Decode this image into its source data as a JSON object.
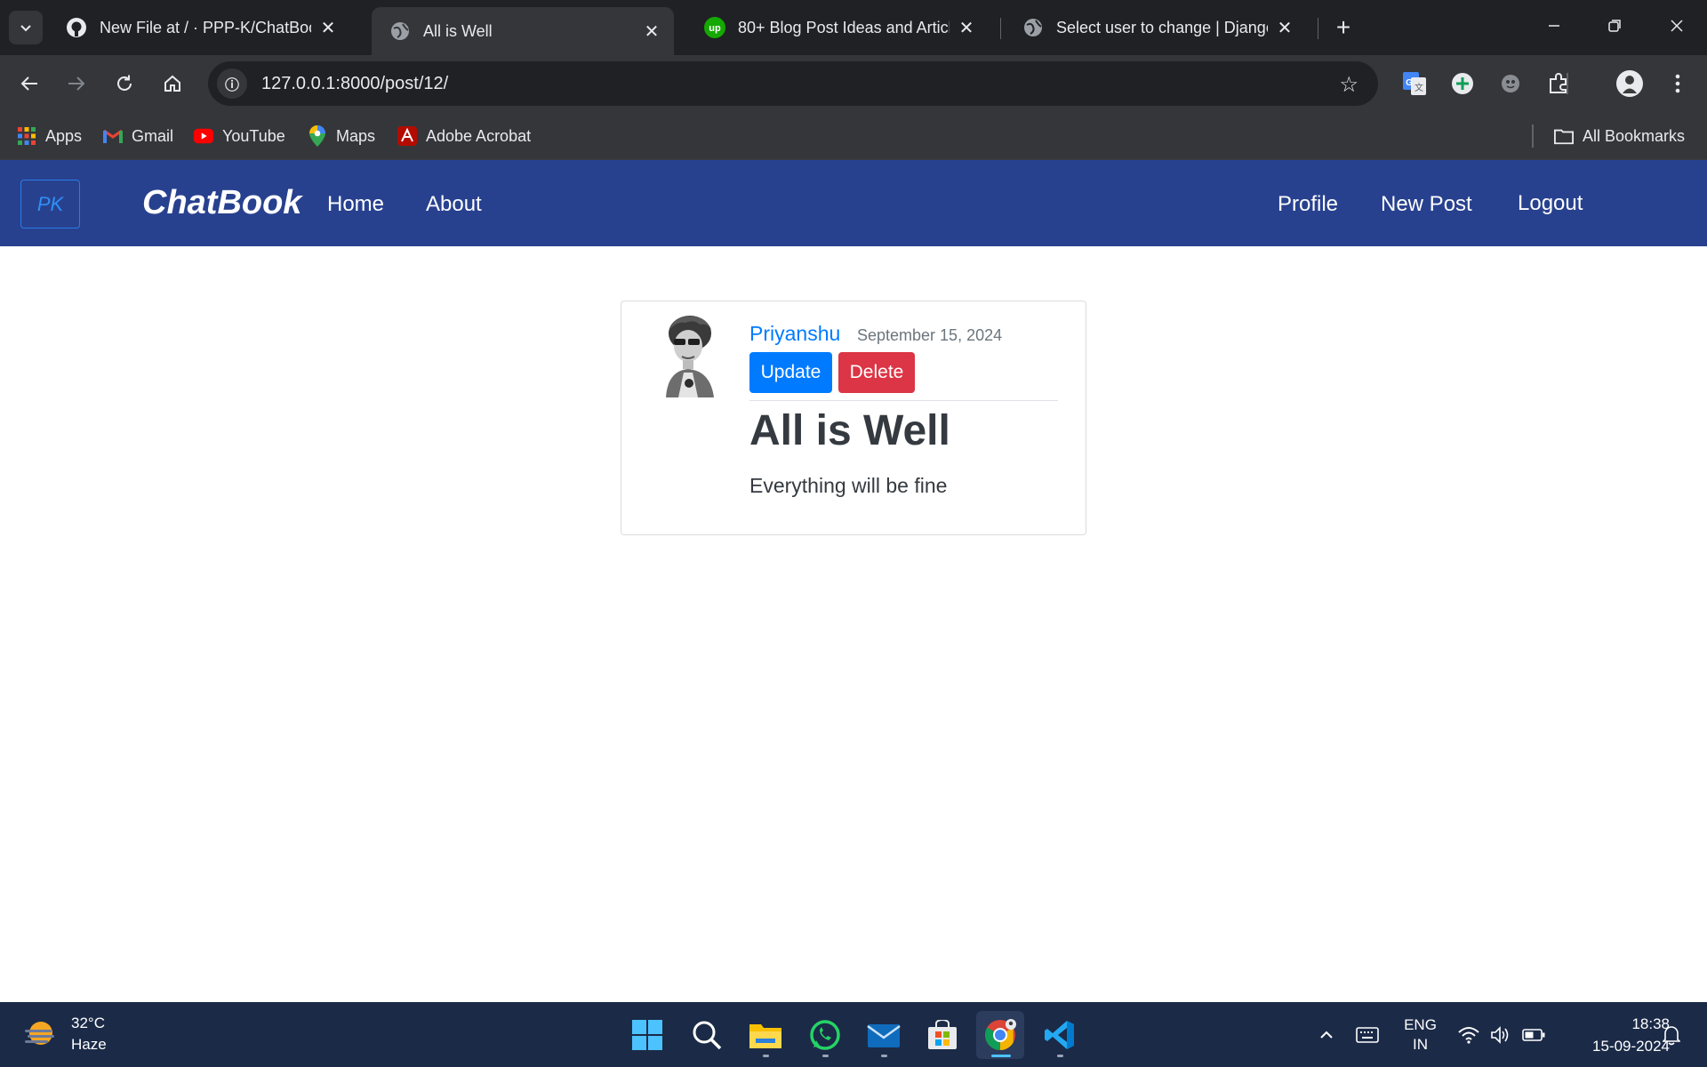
{
  "browser": {
    "tabs": [
      {
        "title": "New File at / · PPP-K/ChatBook",
        "icon": "github-icon",
        "active": false
      },
      {
        "title": "All is Well",
        "icon": "globe-icon",
        "active": true
      },
      {
        "title": "80+ Blog Post Ideas and Article",
        "icon": "upwork-icon",
        "active": false
      },
      {
        "title": "Select user to change | Django s",
        "icon": "globe-icon",
        "active": false
      }
    ],
    "url": "127.0.0.1:8000/post/12/",
    "bookmarks": [
      {
        "label": "Apps",
        "icon": "apps-grid-icon"
      },
      {
        "label": "Gmail",
        "icon": "gmail-icon"
      },
      {
        "label": "YouTube",
        "icon": "youtube-icon"
      },
      {
        "label": "Maps",
        "icon": "maps-icon"
      },
      {
        "label": "Adobe Acrobat",
        "icon": "acrobat-icon"
      }
    ],
    "all_bookmarks": "All Bookmarks"
  },
  "site": {
    "logo_text": "PK",
    "brand": "ChatBook",
    "nav_left": [
      "Home",
      "About"
    ],
    "nav_right": [
      "Profile",
      "New Post",
      "Logout"
    ],
    "colors": {
      "navbar": "#28418f",
      "primary": "#007bff",
      "danger": "#dc3545"
    }
  },
  "post": {
    "author": "Priyanshu",
    "date": "September 15, 2024",
    "update_label": "Update",
    "delete_label": "Delete",
    "title": "All is Well",
    "content": "Everything will be fine"
  },
  "taskbar": {
    "weather_temp": "32°C",
    "weather_desc": "Haze",
    "apps": [
      "windows-start-icon",
      "search-icon",
      "file-explorer-icon",
      "whatsapp-icon",
      "mail-icon",
      "microsoft-store-icon",
      "chrome-icon",
      "vscode-icon"
    ],
    "lang_top": "ENG",
    "lang_bottom": "IN",
    "time": "18:38",
    "date": "15-09-2024"
  }
}
